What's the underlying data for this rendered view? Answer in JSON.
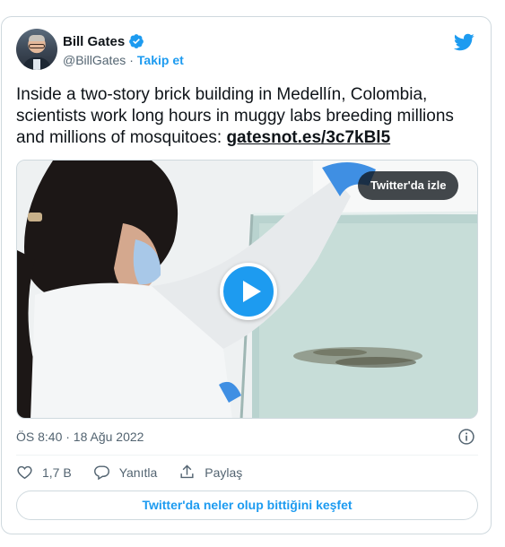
{
  "author": {
    "name": "Bill Gates",
    "handle": "@BillGates",
    "separator": "·",
    "follow_label": "Takip et"
  },
  "tweet": {
    "text": "Inside a two-story brick building in Medellín, Colombia, scientists work long hours in muggy labs breeding millions and millions of mosquitoes: ",
    "link": "gatesnot.es/3c7kBl5"
  },
  "media": {
    "watch_label": "Twitter'da izle"
  },
  "timestamp": "ÖS 8:40 · 18 Ağu 2022",
  "actions": {
    "like_count": "1,7 B",
    "reply_label": "Yanıtla",
    "share_label": "Paylaş"
  },
  "explore_label": "Twitter'da neler olup bittiğini keşfet",
  "colors": {
    "accent": "#1d9bf0",
    "text": "#0f1419",
    "secondary": "#536471",
    "border": "#cfd9de"
  },
  "icons": [
    "verified-badge-icon",
    "twitter-bird-icon",
    "play-icon",
    "info-icon",
    "heart-icon",
    "reply-icon",
    "share-icon"
  ]
}
